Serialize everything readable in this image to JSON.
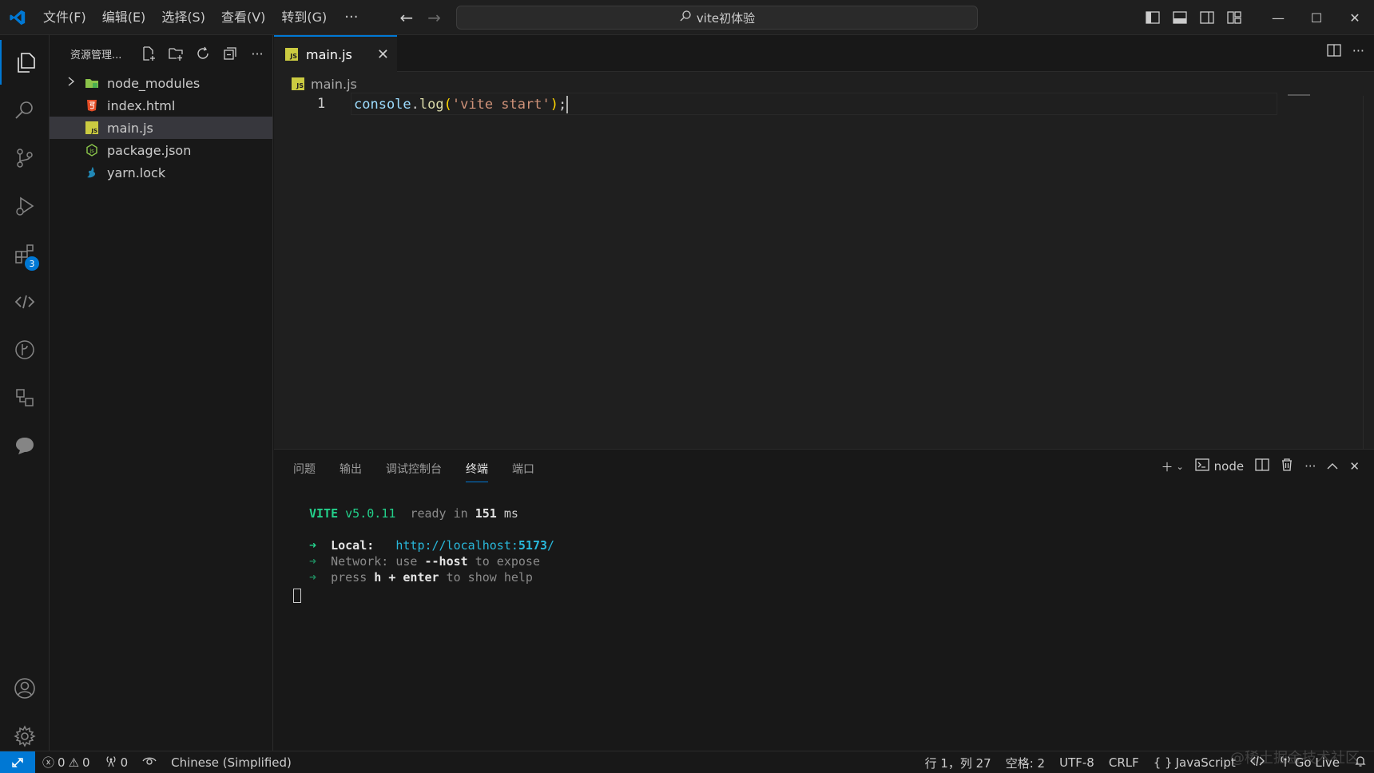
{
  "titlebar": {
    "menu": [
      "文件(F)",
      "编辑(E)",
      "选择(S)",
      "查看(V)",
      "转到(G)"
    ],
    "more": "···",
    "search_text": "vite初体验"
  },
  "activitybar": {
    "extensions_badge": "3"
  },
  "sidebar": {
    "title": "资源管理...",
    "more": "···",
    "files": [
      {
        "name": "node_modules",
        "icon": "folder-icon"
      },
      {
        "name": "index.html",
        "icon": "html-icon"
      },
      {
        "name": "main.js",
        "icon": "js-icon"
      },
      {
        "name": "package.json",
        "icon": "nodejs-icon"
      },
      {
        "name": "yarn.lock",
        "icon": "yarn-icon"
      }
    ]
  },
  "editor": {
    "tab_label": "main.js",
    "breadcrumb": "main.js",
    "line_number": "1",
    "code": {
      "obj": "console",
      "dot": ".",
      "fn": "log",
      "open": "(",
      "str": "'vite start'",
      "close": ")",
      "semi": ";"
    }
  },
  "panel": {
    "tabs": [
      "问题",
      "输出",
      "调试控制台",
      "终端",
      "端口"
    ],
    "active_tab": "终端",
    "terminal_name": "node",
    "terminal": {
      "vite": "VITE",
      "version": "v5.0.11",
      "ready": "ready in",
      "ms_value": "151",
      "ms": "ms",
      "arrow": "➜",
      "local_label": "Local:",
      "local_url_prefix": "http://localhost:",
      "local_port": "5173",
      "local_url_suffix": "/",
      "network_label": "Network:",
      "network_use": "use",
      "network_flag": "--host",
      "network_tail": "to expose",
      "press": "press",
      "h_enter": "h + enter",
      "help_tail": "to show help"
    }
  },
  "statusbar": {
    "errors": "0",
    "warnings": "0",
    "ports": "0",
    "language_pack": "Chinese (Simplified)",
    "position": "行 1，列 27",
    "indent": "空格: 2",
    "encoding": "UTF-8",
    "eol": "CRLF",
    "language": "JavaScript",
    "golive": "Go Live"
  },
  "watermark": "@稀土掘金技术社区",
  "colors": {
    "accent": "#0078d4",
    "background": "#1f1f1f",
    "sidebar": "#181818"
  }
}
